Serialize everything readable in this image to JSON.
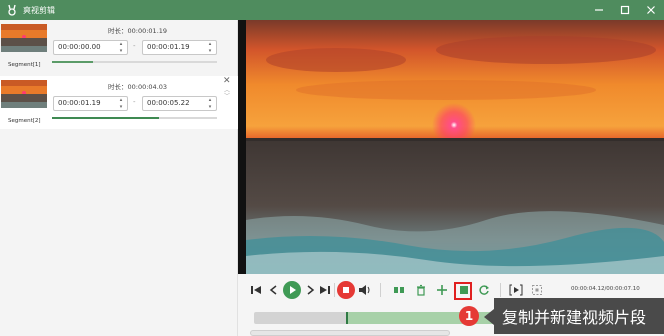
{
  "window": {
    "title": "爽视剪辑",
    "app_icon": "rabbit-logo-icon",
    "controls": [
      "minimize-icon",
      "maximize-icon",
      "close-icon"
    ]
  },
  "segments": [
    {
      "name": "Segment[1]",
      "duration_label": "时长：",
      "duration": "00:00:01.19",
      "start": "00:00:00.00",
      "end": "00:00:01.19",
      "selected": false
    },
    {
      "name": "Segment[2]",
      "duration_label": "时长：",
      "duration": "00:00:04.03",
      "start": "00:00:01.19",
      "end": "00:00:05.22",
      "selected": true
    }
  ],
  "player": {
    "timecode": "00:00:04.12/00:00:07.10",
    "buttons": [
      "mark-in-icon",
      "step-back-icon",
      "play-icon",
      "step-forward-icon",
      "mark-out-icon",
      "stop-icon",
      "volume-icon",
      "split-icon",
      "delete-icon",
      "add-icon",
      "copy-new-segment-icon",
      "reset-icon",
      "preview-segment-icon",
      "fit-icon"
    ],
    "accent_green": "#3f9a55",
    "accent_red": "#e53935"
  },
  "callout": {
    "number": "1",
    "text": "复制并新建视频片段"
  }
}
